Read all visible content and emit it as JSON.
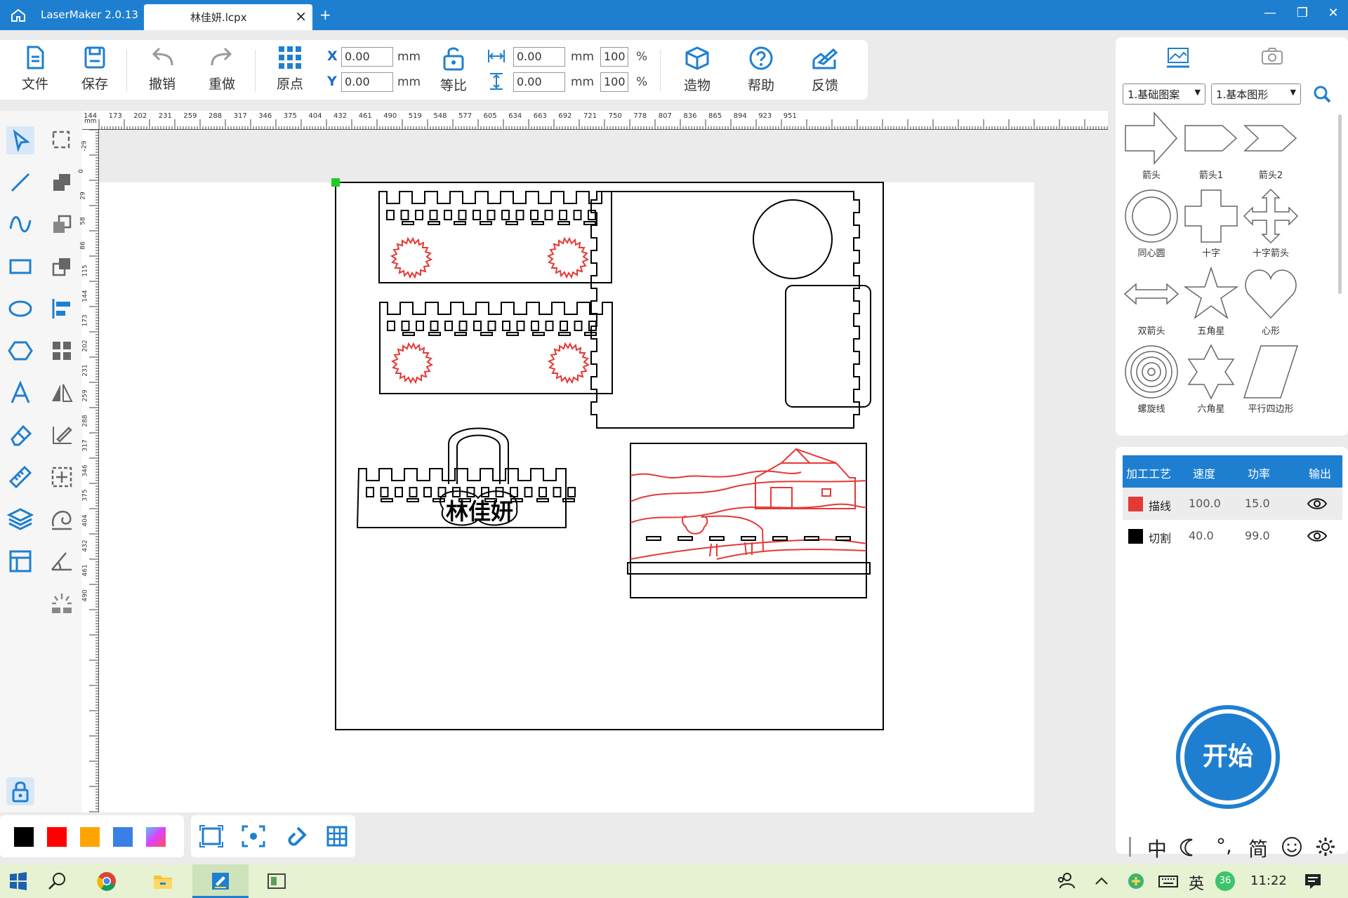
{
  "window": {
    "app_title": "LaserMaker 2.0.13",
    "tab_name": "林佳妍.lcpx",
    "tab_close": "×",
    "tab_add": "+",
    "minimize": "—",
    "restore": "❐",
    "close": "✕"
  },
  "toolbar": {
    "file": "文件",
    "save": "保存",
    "undo": "撤销",
    "redo": "重做",
    "origin": "原点",
    "x_label": "X",
    "y_label": "Y",
    "x_value": "0.00",
    "y_value": "0.00",
    "unit": "mm",
    "proportional": "等比",
    "w_value": "0.00",
    "h_value": "0.00",
    "w_pct": "100",
    "h_pct": "100",
    "pct": "%",
    "build": "造物",
    "help": "帮助",
    "feedback": "反馈"
  },
  "library": {
    "category": "1.基础图案",
    "subcategory": "1.基本图形",
    "shapes": [
      "箭头",
      "箭头1",
      "箭头2",
      "同心圆",
      "十字",
      "十字箭头",
      "双箭头",
      "五角星",
      "心形",
      "螺旋线",
      "六角星",
      "平行四边形"
    ]
  },
  "layers": {
    "headers": [
      "加工工艺",
      "速度",
      "功率",
      "输出"
    ],
    "rows": [
      {
        "name": "描线",
        "speed": "100.0",
        "power": "15.0",
        "color": "#e53935"
      },
      {
        "name": "切割",
        "speed": "40.0",
        "power": "99.0",
        "color": "#000000"
      }
    ]
  },
  "start_button": "开始",
  "ruler": {
    "unit": "mm",
    "top_ticks": [
      "144",
      "173",
      "202",
      "231",
      "259",
      "288",
      "317",
      "346",
      "375",
      "404",
      "432",
      "461",
      "490",
      "519",
      "548",
      "577",
      "605",
      "634",
      "663",
      "692",
      "721",
      "750",
      "778",
      "807",
      "836",
      "865",
      "894",
      "923",
      "951"
    ],
    "left_ticks": [
      "-29",
      "0",
      "29",
      "58",
      "86",
      "115",
      "144",
      "173",
      "202",
      "231",
      "259",
      "288",
      "317",
      "346",
      "375",
      "404",
      "432",
      "461",
      "490"
    ]
  },
  "canvas": {
    "name_text": "林佳妍"
  },
  "palette": [
    "#000000",
    "#ff0000",
    "#ffa500",
    "#3a7fe6",
    "gradient"
  ],
  "ime": {
    "lang": "中",
    "punct": "°,",
    "simp": "简"
  },
  "taskbar": {
    "lang": "英",
    "badge": "36",
    "time": "11:22"
  }
}
